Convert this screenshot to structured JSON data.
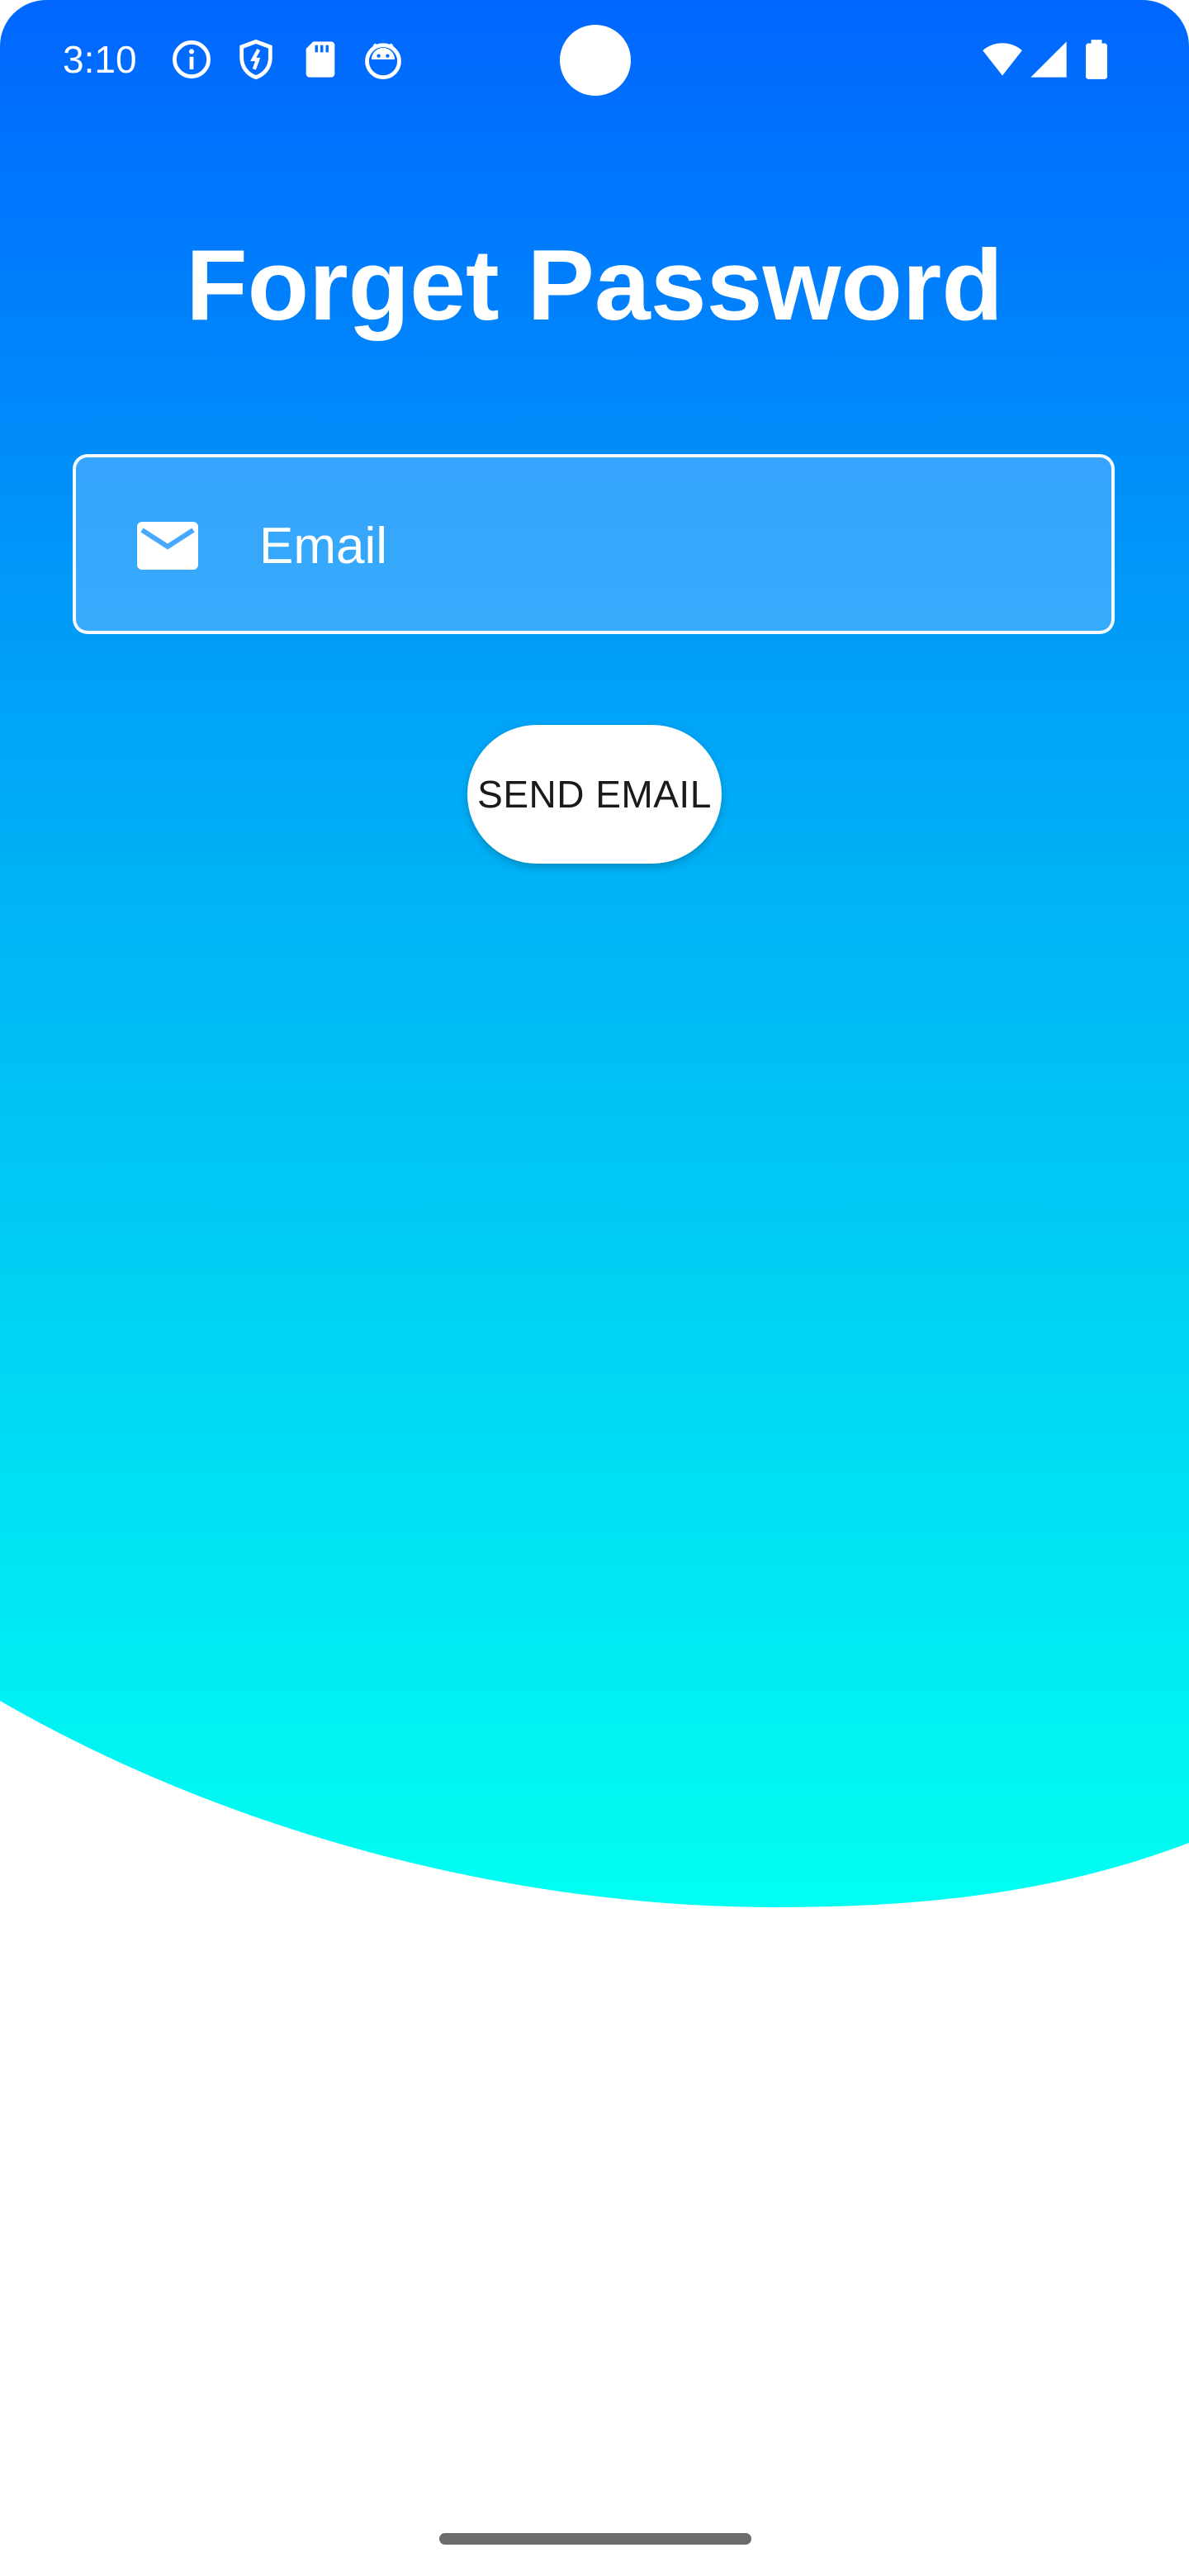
{
  "status_bar": {
    "time": "3:10",
    "left_icons": [
      "info-icon",
      "shield-icon",
      "sd-card-icon",
      "android-debug-icon"
    ],
    "right_icons": [
      "wifi-icon",
      "cell-signal-icon",
      "battery-icon"
    ]
  },
  "page": {
    "title": "Forget Password"
  },
  "email_field": {
    "icon": "mail-icon",
    "placeholder": "Email",
    "value": ""
  },
  "send_button": {
    "label": "SEND EMAIL"
  },
  "colors": {
    "gradient_top": "#0066FF",
    "gradient_mid": "#00AAF7",
    "gradient_bottom": "#00FFF2",
    "background": "#FFFFFF",
    "text_on_gradient": "#FFFFFF",
    "button_text": "#1A1A1A"
  }
}
